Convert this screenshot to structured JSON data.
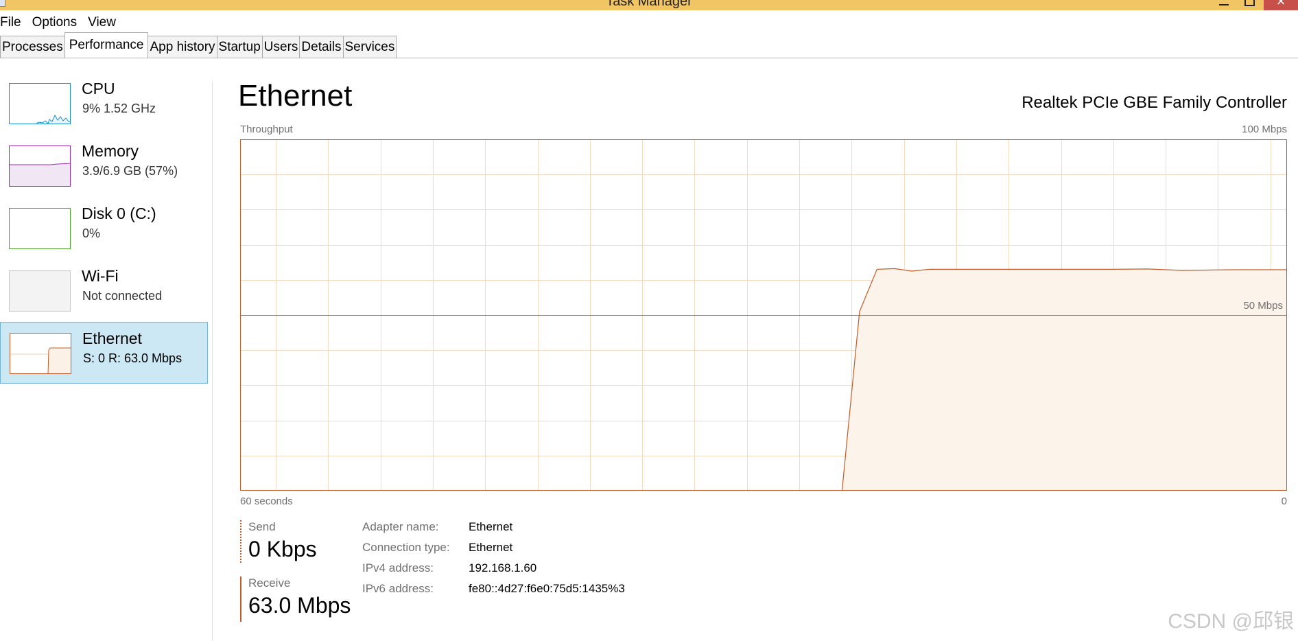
{
  "window": {
    "title": "Task Manager",
    "close_glyph": "×"
  },
  "menu": [
    "File",
    "Options",
    "View"
  ],
  "tabs": [
    {
      "label": "Processes"
    },
    {
      "label": "Performance",
      "active": true
    },
    {
      "label": "App history"
    },
    {
      "label": "Startup"
    },
    {
      "label": "Users"
    },
    {
      "label": "Details"
    },
    {
      "label": "Services"
    }
  ],
  "sidebar": {
    "items": [
      {
        "name": "CPU",
        "sub": "9%  1.52 GHz",
        "color": "#1c8fd1"
      },
      {
        "name": "Memory",
        "sub": "3.9/6.9 GB (57%)",
        "color": "#9b2fae"
      },
      {
        "name": "Disk 0 (C:)",
        "sub": "0%",
        "color": "#4da631"
      },
      {
        "name": "Wi-Fi",
        "sub": "Not connected",
        "color": "#c0c0c0"
      },
      {
        "name": "Ethernet",
        "sub": "S: 0  R: 63.0 Mbps",
        "color": "#c35a28",
        "selected": true
      }
    ]
  },
  "main": {
    "title": "Ethernet",
    "adapter_title": "Realtek PCIe GBE Family Controller",
    "graph": {
      "top_left_label": "Throughput",
      "top_right_label": "100 Mbps",
      "mid_label": "50 Mbps",
      "bottom_left_label": "60 seconds",
      "bottom_right_label": "0"
    },
    "send": {
      "label": "Send",
      "value": "0 Kbps"
    },
    "receive": {
      "label": "Receive",
      "value": "63.0 Mbps"
    },
    "details": [
      {
        "key": "Adapter name:",
        "value": "Ethernet"
      },
      {
        "key": "Connection type:",
        "value": "Ethernet"
      },
      {
        "key": "IPv4 address:",
        "value": "192.168.1.60"
      },
      {
        "key": "IPv6 address:",
        "value": "fe80::4d27:f6e0:75d5:1435%3"
      }
    ]
  },
  "watermark": "CSDN @邱银",
  "colors": {
    "titlebar": "#f2c564",
    "ethernet_accent": "#c35a28",
    "graph_fill": "#fcf3ea",
    "grid": "#f4d9c3",
    "selected_bg": "#cce8f4"
  },
  "chart_data": {
    "type": "area",
    "xlabel": "60 seconds",
    "x_unit": "seconds ago",
    "ylim": [
      0,
      100
    ],
    "y_unit": "Mbps",
    "series": [
      {
        "name": "Receive",
        "x": [
          60,
          25.5,
          24.5,
          23.5,
          22.5,
          21.5,
          20.5,
          19,
          17,
          14,
          10,
          8,
          6,
          3,
          0
        ],
        "values": [
          0,
          0,
          51,
          63,
          63.2,
          62.5,
          63,
          63,
          63,
          63,
          63,
          63.1,
          62.7,
          62.9,
          62.9
        ]
      }
    ]
  }
}
